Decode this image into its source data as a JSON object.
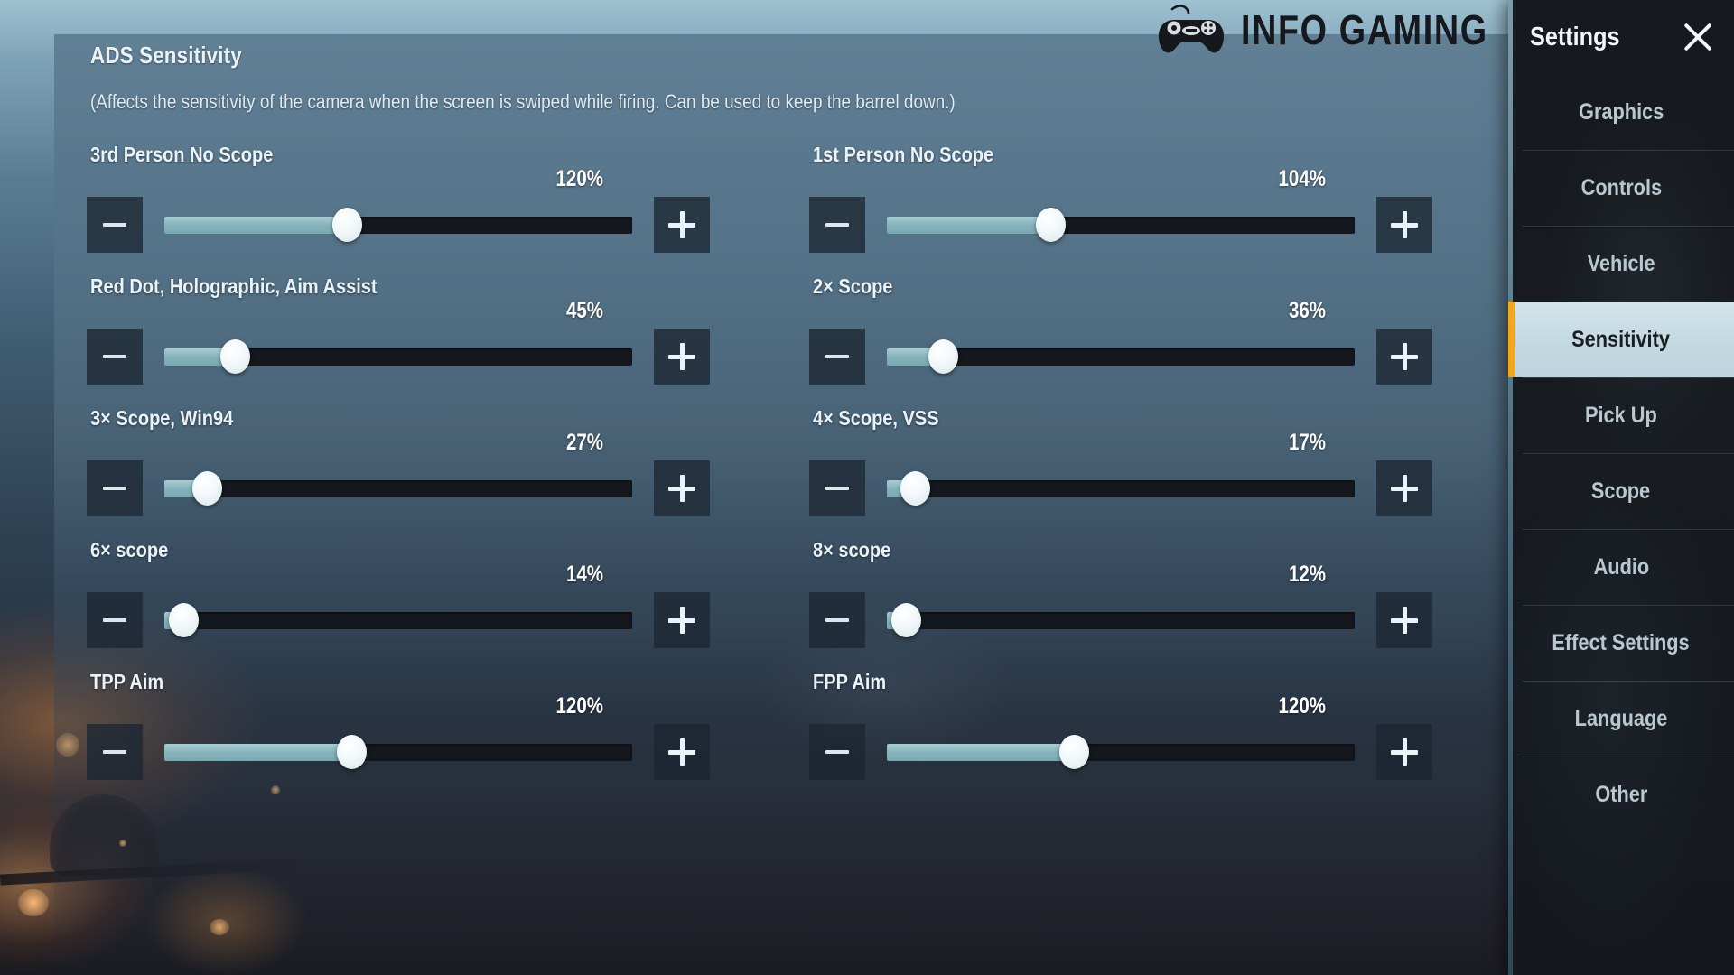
{
  "watermark": {
    "text": "INFO GAMING",
    "icon": "gamepad-icon"
  },
  "content": {
    "section_title": "ADS Sensitivity",
    "section_description": "(Affects the sensitivity of the camera when the screen is swiped while firing. Can be used to keep the barrel down.)",
    "decrease_glyph": "−",
    "increase_glyph": "+",
    "sliders": [
      {
        "label": "3rd Person No Scope",
        "value": "120%",
        "percent": 39
      },
      {
        "label": "1st Person No Scope",
        "value": "104%",
        "percent": 35
      },
      {
        "label": "Red Dot, Holographic, Aim Assist",
        "value": "45%",
        "percent": 15
      },
      {
        "label": "2× Scope",
        "value": "36%",
        "percent": 12
      },
      {
        "label": "3× Scope, Win94",
        "value": "27%",
        "percent": 9
      },
      {
        "label": "4× Scope, VSS",
        "value": "17%",
        "percent": 6
      },
      {
        "label": "6× scope",
        "value": "14%",
        "percent": 4
      },
      {
        "label": "8× scope",
        "value": "12%",
        "percent": 4
      },
      {
        "label": "TPP Aim",
        "value": "120%",
        "percent": 40
      },
      {
        "label": "FPP Aim",
        "value": "120%",
        "percent": 40
      }
    ]
  },
  "sidebar": {
    "title": "Settings",
    "close_icon": "close-icon",
    "accent_color": "#f0a81e",
    "items": [
      {
        "label": "Graphics",
        "active": false
      },
      {
        "label": "Controls",
        "active": false
      },
      {
        "label": "Vehicle",
        "active": false
      },
      {
        "label": "Sensitivity",
        "active": true
      },
      {
        "label": "Pick Up",
        "active": false
      },
      {
        "label": "Scope",
        "active": false
      },
      {
        "label": "Audio",
        "active": false
      },
      {
        "label": "Effect Settings",
        "active": false
      },
      {
        "label": "Language",
        "active": false
      },
      {
        "label": "Other",
        "active": false
      }
    ]
  }
}
